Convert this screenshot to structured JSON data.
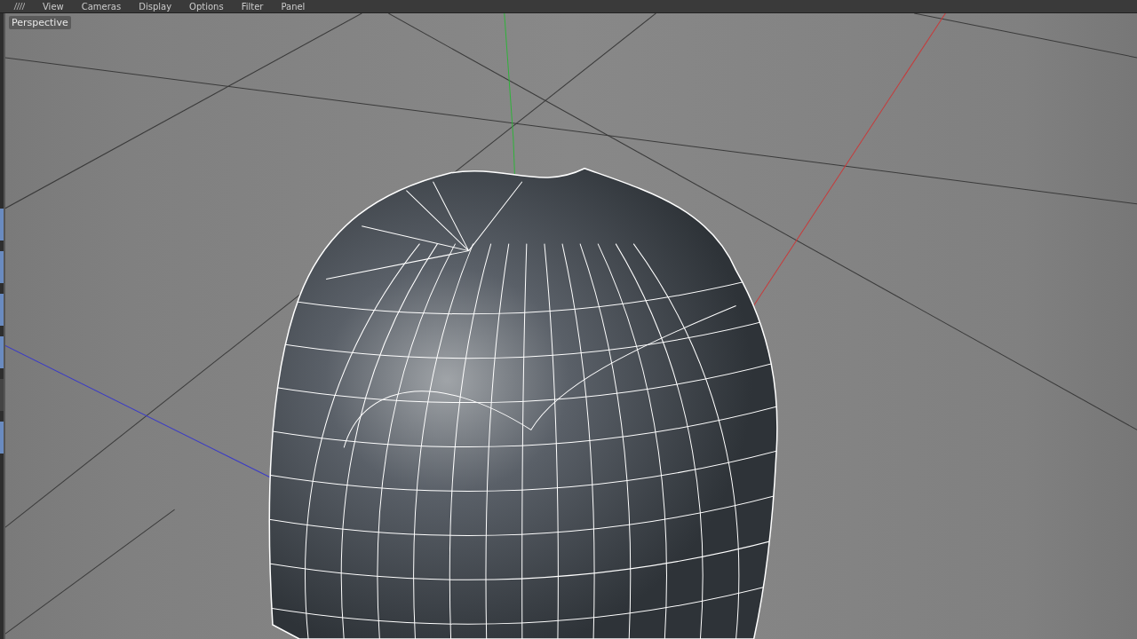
{
  "menu": [
    "View",
    "Cameras",
    "Display",
    "Options",
    "Filter",
    "Panel"
  ],
  "viewport": {
    "label": "Perspective"
  }
}
